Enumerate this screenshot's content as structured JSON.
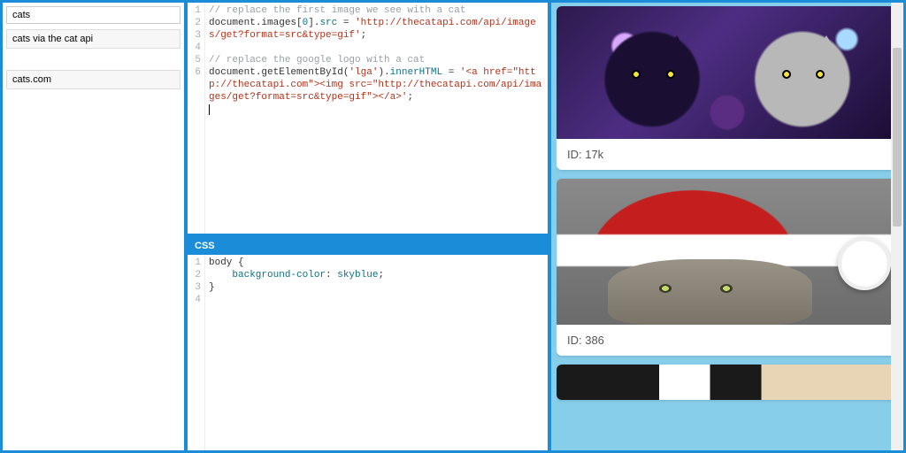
{
  "sidebar": {
    "search_value": "cats",
    "items": [
      "cats via the cat api"
    ],
    "secondary_items": [
      "cats.com"
    ]
  },
  "editors": {
    "js": {
      "line_count": 6,
      "lines": [
        {
          "type": "comment",
          "text": "// replace the first image we see with a cat"
        },
        {
          "type": "code",
          "segments": [
            {
              "t": "document",
              "c": "c-obj"
            },
            {
              "t": ".",
              "c": ""
            },
            {
              "t": "images",
              "c": "c-obj"
            },
            {
              "t": "[",
              "c": ""
            },
            {
              "t": "0",
              "c": "c-prop"
            },
            {
              "t": "].",
              "c": ""
            },
            {
              "t": "src",
              "c": "c-prop"
            },
            {
              "t": " = ",
              "c": ""
            },
            {
              "t": "'http://thecatapi.com/api/images/get?format=src&type=gif'",
              "c": "c-str"
            },
            {
              "t": ";",
              "c": ""
            }
          ]
        },
        {
          "type": "blank",
          "text": ""
        },
        {
          "type": "comment",
          "text": "// replace the google logo with a cat"
        },
        {
          "type": "code",
          "segments": [
            {
              "t": "document",
              "c": "c-obj"
            },
            {
              "t": ".",
              "c": ""
            },
            {
              "t": "getElementById",
              "c": "c-obj"
            },
            {
              "t": "(",
              "c": ""
            },
            {
              "t": "'lga'",
              "c": "c-str"
            },
            {
              "t": ").",
              "c": ""
            },
            {
              "t": "innerHTML",
              "c": "c-prop"
            },
            {
              "t": " = ",
              "c": ""
            },
            {
              "t": "'<a href=\"http://thecatapi.com\"><img src=\"http://thecatapi.com/api/images/get?format=src&type=gif\"></a>'",
              "c": "c-str"
            },
            {
              "t": ";",
              "c": ""
            }
          ]
        },
        {
          "type": "cursor",
          "text": ""
        }
      ]
    },
    "css": {
      "header": "CSS",
      "line_count": 4,
      "lines": [
        {
          "type": "code",
          "segments": [
            {
              "t": "body ",
              "c": "c-obj"
            },
            {
              "t": "{",
              "c": ""
            }
          ]
        },
        {
          "type": "code",
          "segments": [
            {
              "t": "    ",
              "c": ""
            },
            {
              "t": "background-color",
              "c": "c-prop"
            },
            {
              "t": ": ",
              "c": ""
            },
            {
              "t": "skyblue",
              "c": "c-key"
            },
            {
              "t": ";",
              "c": ""
            }
          ]
        },
        {
          "type": "code",
          "segments": [
            {
              "t": "}",
              "c": ""
            }
          ]
        },
        {
          "type": "blank",
          "text": ""
        }
      ]
    }
  },
  "preview": {
    "bg_color": "skyblue",
    "cards": [
      {
        "caption": "ID: 17k"
      },
      {
        "caption": "ID: 386"
      },
      {
        "caption": ""
      }
    ]
  },
  "colors": {
    "accent": "#1a8cd8",
    "skyblue": "#87ceeb"
  }
}
